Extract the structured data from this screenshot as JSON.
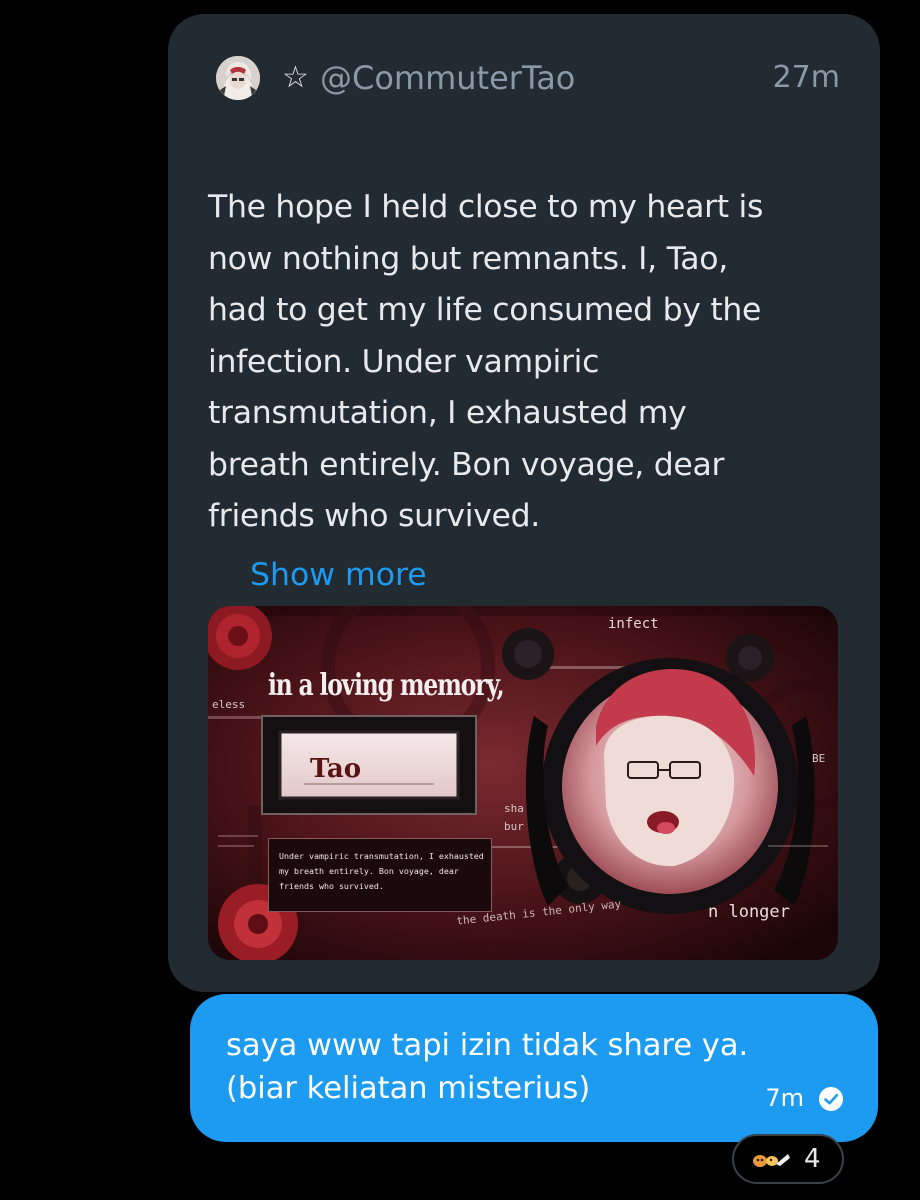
{
  "tweet": {
    "handle": "@CommuterTao",
    "star_glyph": "☆",
    "time": "27m",
    "body": "The hope I held close to my heart is\nnow nothing but remnants. I, Tao,\nhad to get my life consumed by the\ninfection. Under vampiric\ntransmutation, I exhausted my\nbreath entirely. Bon voyage, dear\nfriends who survived.",
    "show_more": "Show more",
    "media": {
      "heading": "in a loving memory,",
      "top_word": "infect",
      "name_plate": "Tao",
      "left_small": "eless",
      "side_word_1": "sha",
      "side_word_2": "bur",
      "right_small": "BE",
      "quote": "Under vampiric transmutation, I exhausted my breath entirely. Bon voyage, dear friends who survived.",
      "bottom_left": "the death is the only way",
      "bottom_right": "n  longer"
    }
  },
  "reply": {
    "text": "saya www tapi izin tidak share ya.\n(biar keliatan misterius)",
    "time": "7m",
    "status_icon": "read-check-icon"
  },
  "reaction": {
    "emoji_icon": "reaction-emoji-icon",
    "count": "4"
  },
  "colors": {
    "background": "#000000",
    "card": "#222a32",
    "accent": "#1d9bf0",
    "muted_text": "#8b98a5",
    "primary_text": "#e7e9ea"
  }
}
